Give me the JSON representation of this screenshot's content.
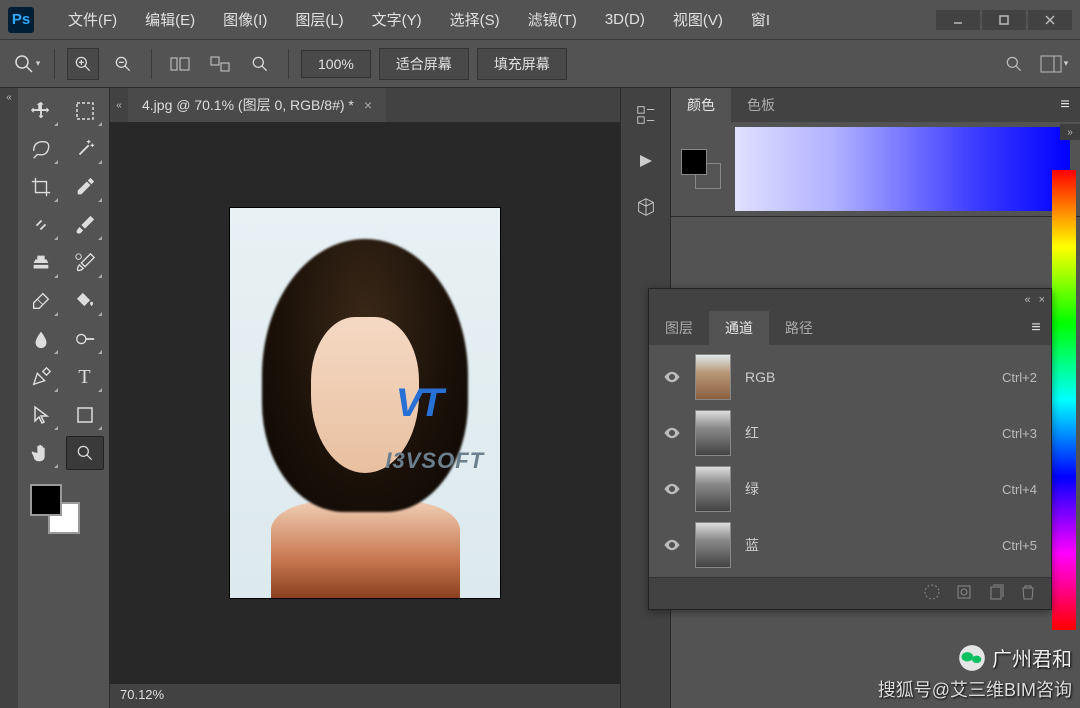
{
  "app": {
    "logo": "Ps"
  },
  "menu": {
    "file": "文件(F)",
    "edit": "编辑(E)",
    "image": "图像(I)",
    "layer": "图层(L)",
    "type": "文字(Y)",
    "select": "选择(S)",
    "filter": "滤镜(T)",
    "threed": "3D(D)",
    "view": "视图(V)",
    "window": "窗I"
  },
  "options": {
    "zoom_value": "100%",
    "fit_screen": "适合屏幕",
    "fill_screen": "填充屏幕"
  },
  "document": {
    "tab_title": "4.jpg @ 70.1% (图层 0, RGB/8#) *",
    "status_zoom": "70.12%"
  },
  "panels": {
    "color": {
      "tab_color": "颜色",
      "tab_swatches": "色板"
    },
    "layers": {
      "tab_layers": "图层",
      "tab_channels": "通道",
      "tab_paths": "路径",
      "channels": [
        {
          "name": "RGB",
          "shortcut": "Ctrl+2",
          "thumb": "rgb"
        },
        {
          "name": "红",
          "shortcut": "Ctrl+3",
          "thumb": "gray"
        },
        {
          "name": "绿",
          "shortcut": "Ctrl+4",
          "thumb": "gray"
        },
        {
          "name": "蓝",
          "shortcut": "Ctrl+5",
          "thumb": "gray"
        }
      ]
    }
  },
  "watermark": {
    "logo_text": "VT",
    "brand": "I3VSOFT",
    "wechat": "广州君和",
    "sohu": "搜狐号@艾三维BIM咨询"
  },
  "collapse_marker": "«",
  "expand_marker": "»"
}
